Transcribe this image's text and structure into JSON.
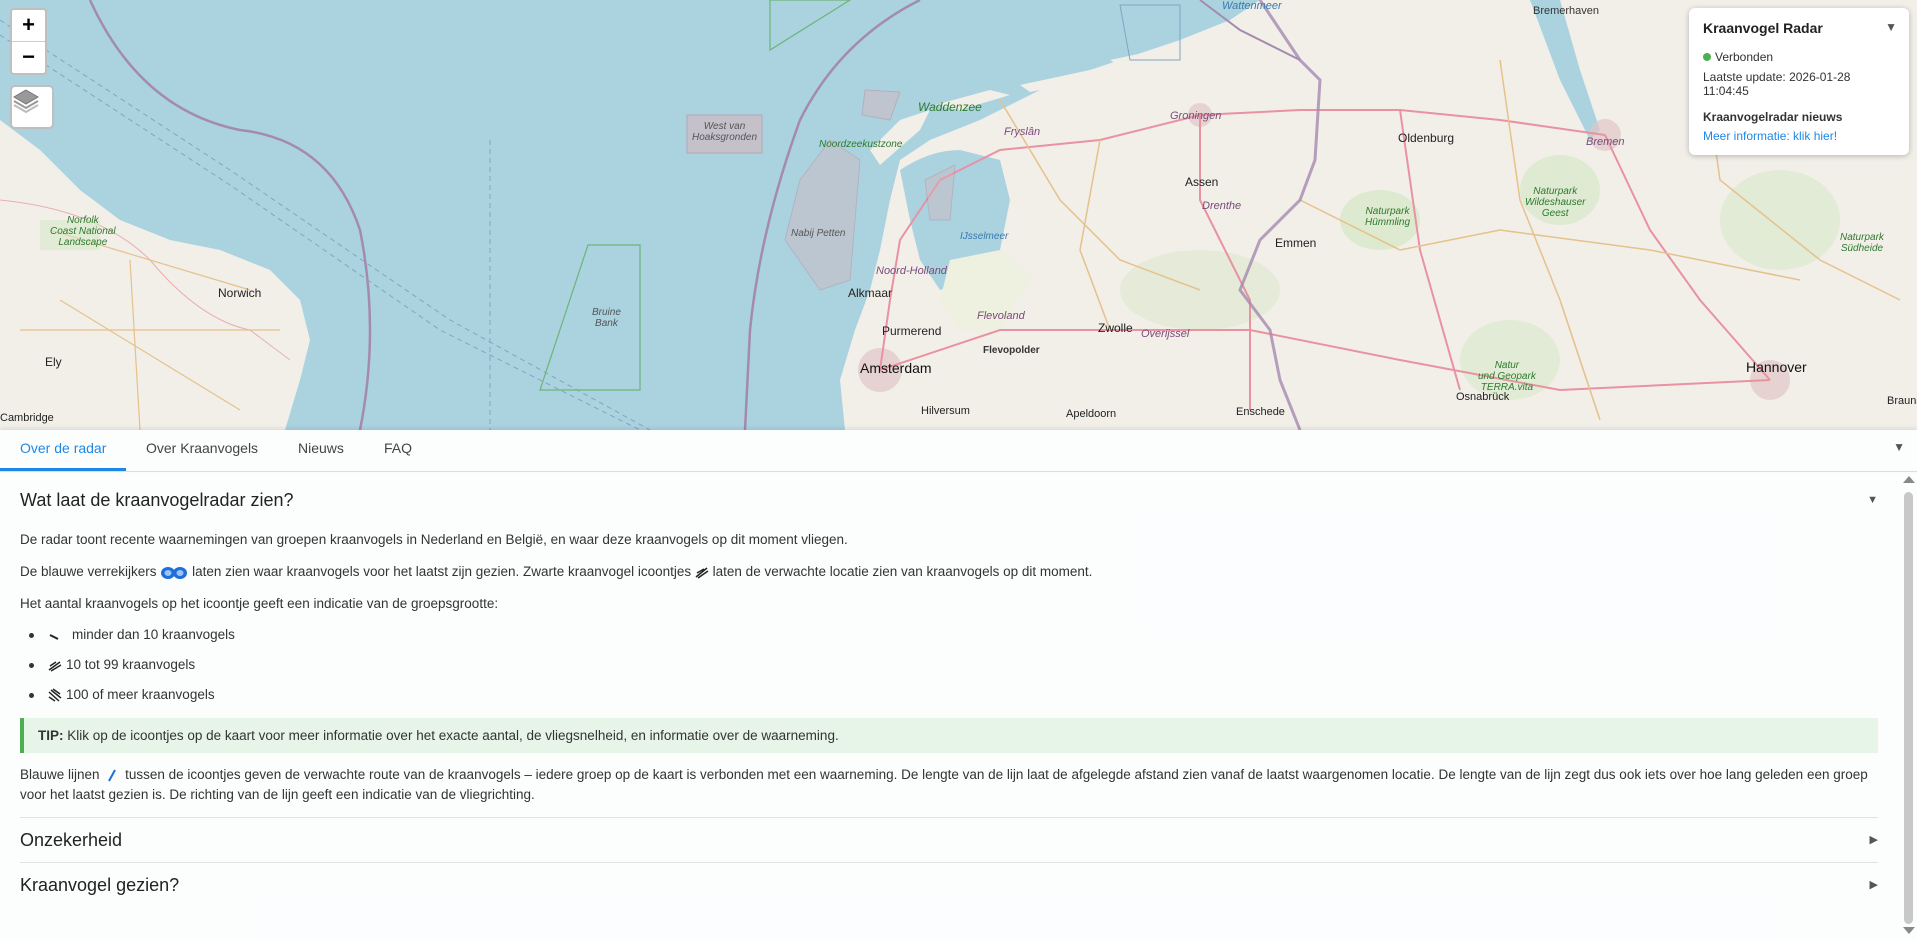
{
  "map": {
    "zoom_in": "+",
    "zoom_out": "−",
    "labels": {
      "wattenmeer": "Wattenmeer",
      "bremerhaven": "Bremerhaven",
      "west_van_hoaksgronden_1": "West van",
      "west_van_hoaksgronden_2": "Hoaksgronden",
      "noordzeekustzone": "Noordzeekustzone",
      "waddenzee": "Waddenzee",
      "fryslan": "Fryslân",
      "groningen": "Groningen",
      "oldenburg": "Oldenburg",
      "bremen": "Bremen",
      "assen": "Assen",
      "drenthe": "Drenthe",
      "norfolk_1": "Norfolk",
      "norfolk_2": "Coast National",
      "norfolk_3": "Landscape",
      "nabij_petten": "Nabij Petten",
      "ijsselmeer": "IJsselmeer",
      "emmen": "Emmen",
      "naturpark_hummling_1": "Naturpark",
      "naturpark_hummling_2": "Hümmling",
      "naturpark_wildeshauser_1": "Naturpark",
      "naturpark_wildeshauser_2": "Wildeshauser",
      "naturpark_wildeshauser_3": "Geest",
      "naturpark_sudheide_1": "Naturpark",
      "naturpark_sudheide_2": "Südheide",
      "norwich": "Norwich",
      "noord_holland": "Noord-Holland",
      "alkmaar": "Alkmaar",
      "bruine_bank_1": "Bruine",
      "bruine_bank_2": "Bank",
      "flevoland": "Flevoland",
      "purmerend": "Purmerend",
      "zwolle": "Zwolle",
      "overijssel": "Overijssel",
      "ely": "Ely",
      "flevopolder": "Flevopolder",
      "amsterdam": "Amsterdam",
      "hannover": "Hannover",
      "natur_geopark_1": "Natur",
      "natur_geopark_2": "und Geopark",
      "natur_geopark_3": "TERRA.vita",
      "osnabruck": "Osnabrück",
      "cambridge": "Cambridge",
      "hilversum": "Hilversum",
      "apeldoorn": "Apeldoorn",
      "enschede": "Enschede",
      "braun": "Brauns"
    }
  },
  "radar": {
    "title": "Kraanvogel Radar",
    "toggle": "▼",
    "status": "Verbonden",
    "last_update": "Laatste update: 2026-01-28 11:04:45",
    "news_title": "Kraanvogelradar nieuws",
    "news_link": "Meer informatie: klik hier!",
    "status_color": "#4caf50"
  },
  "tabs": [
    {
      "label": "Over de radar"
    },
    {
      "label": "Over Kraanvogels"
    },
    {
      "label": "Nieuws"
    },
    {
      "label": "FAQ"
    }
  ],
  "tabs_toggle": "▼",
  "content": {
    "title": "Wat laat de kraanvogelradar zien?",
    "title_arrow": "▼",
    "p1": "De radar toont recente waarnemingen van groepen kraanvogels in Nederland en België, en waar deze kraanvogels op dit moment vliegen.",
    "p2a": "De blauwe verrekijkers",
    "p2b": "laten zien waar kraanvogels voor het laatst zijn gezien. Zwarte kraanvogel icoontjes",
    "p2c": "laten de verwachte locatie zien van kraanvogels op dit moment.",
    "p3": "Het aantal kraanvogels op het icoontje geeft een indicatie van de groepsgrootte:",
    "sizes": [
      "minder dan 10 kraanvogels",
      "10 tot 99 kraanvogels",
      "100 of meer kraanvogels"
    ],
    "tip_label": "TIP:",
    "tip_text": "Klik op de icoontjes op de kaart voor meer informatie over het exacte aantal, de vliegsnelheid, en informatie over de waarneming.",
    "p4a": "Blauwe lijnen",
    "p4b": "tussen de icoontjes geven de verwachte route van de kraanvogels – iedere groep op de kaart is verbonden met een waarneming. De lengte van de lijn laat de afgelegde afstand zien vanaf de laatst waargenomen locatie. De lengte van de lijn zegt dus ook iets over hoe lang geleden een groep voor het laatst gezien is. De richting van de lijn geeft een indicatie van de vliegrichting.",
    "sections": [
      {
        "title": "Onzekerheid",
        "arrow": "▶"
      },
      {
        "title": "Kraanvogel gezien?",
        "arrow": "▶"
      }
    ]
  },
  "colors": {
    "accent": "#1e88e5",
    "tip_bg": "#e7f4e8",
    "tip_border": "#4caf50",
    "sea": "#aad3df",
    "land": "#f2efe9"
  }
}
